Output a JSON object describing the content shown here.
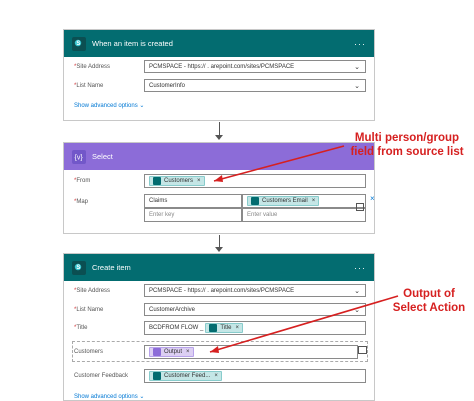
{
  "trigger": {
    "title": "When an item is created",
    "site_label": "Site Address",
    "site_value": "PCMSPACE - https://        .          arepoint.com/sites/PCMSPACE",
    "list_label": "List Name",
    "list_value": "CustomerInfo",
    "advanced": "Show advanced options"
  },
  "select": {
    "title": "Select",
    "from_label": "From",
    "from_token": "Customers",
    "map_label": "Map",
    "map_key1": "Claims",
    "map_value1_token": "Customers Email",
    "map_key_placeholder": "Enter key",
    "map_value_placeholder": "Enter value"
  },
  "create": {
    "title": "Create item",
    "site_label": "Site Address",
    "site_value": "PCMSPACE - https://        .        arepoint.com/sites/PCMSPACE",
    "list_label": "List Name",
    "list_value": "CustomerArchive",
    "title_label": "Title",
    "title_text": "BCDFROM FLOW _",
    "title_token": "Title",
    "customers_label": "Customers",
    "customers_token": "Output",
    "feedback_label": "Customer Feedback",
    "feedback_token": "Customer Feed...",
    "advanced": "Show advanced options"
  },
  "annotations": {
    "top_line1": "Multi person/group",
    "top_line2": "field from source list",
    "bottom_line1": "Output of",
    "bottom_line2": "Select Action"
  },
  "ui": {
    "more": "···",
    "close_x": "×",
    "chevron": "⌄"
  }
}
